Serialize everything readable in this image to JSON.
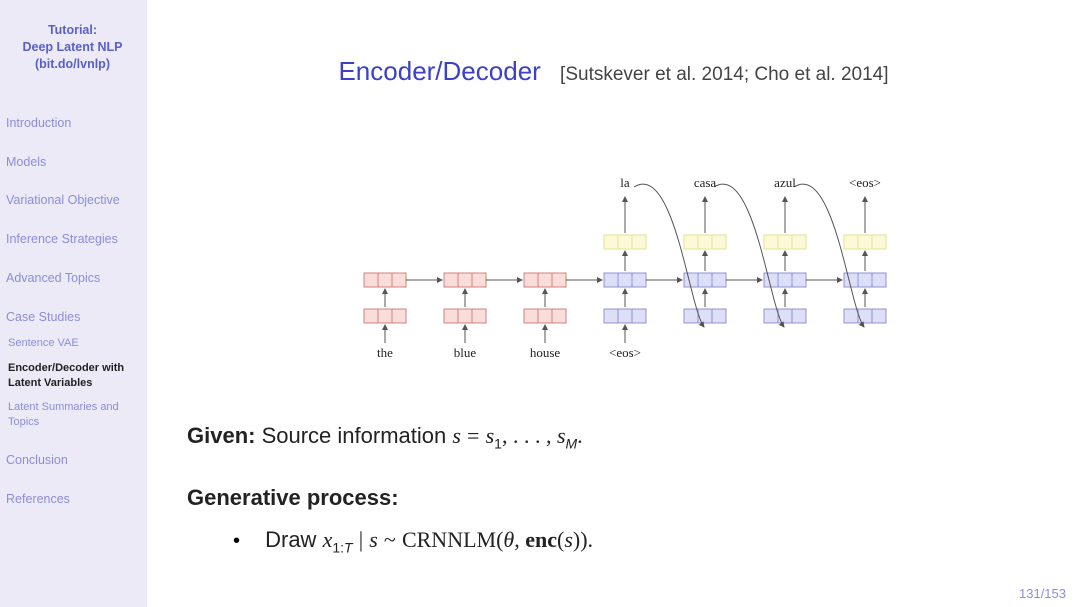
{
  "sidebar": {
    "title_line1": "Tutorial:",
    "title_line2": "Deep Latent NLP",
    "title_line3": "(bit.do/lvnlp)",
    "sections": [
      "Introduction",
      "Models",
      "Variational Objective",
      "Inference Strategies",
      "Advanced Topics",
      "Case Studies"
    ],
    "subsections": [
      "Sentence VAE",
      "Encoder/Decoder with Latent Variables",
      "Latent Summaries and Topics"
    ],
    "tail_sections": [
      "Conclusion",
      "References"
    ]
  },
  "slide": {
    "title_main": "Encoder/Decoder",
    "title_ref": "[Sutskever et al. 2014; Cho et al. 2014]",
    "diagram": {
      "encoder_tokens": [
        "the",
        "blue",
        "house"
      ],
      "decoder_in_tokens": [
        "<eos>",
        "",
        "",
        "",
        ""
      ],
      "decoder_out_tokens": [
        "la",
        "casa",
        "azul",
        "<eos>"
      ]
    }
  },
  "page": {
    "counter": "131/153"
  }
}
